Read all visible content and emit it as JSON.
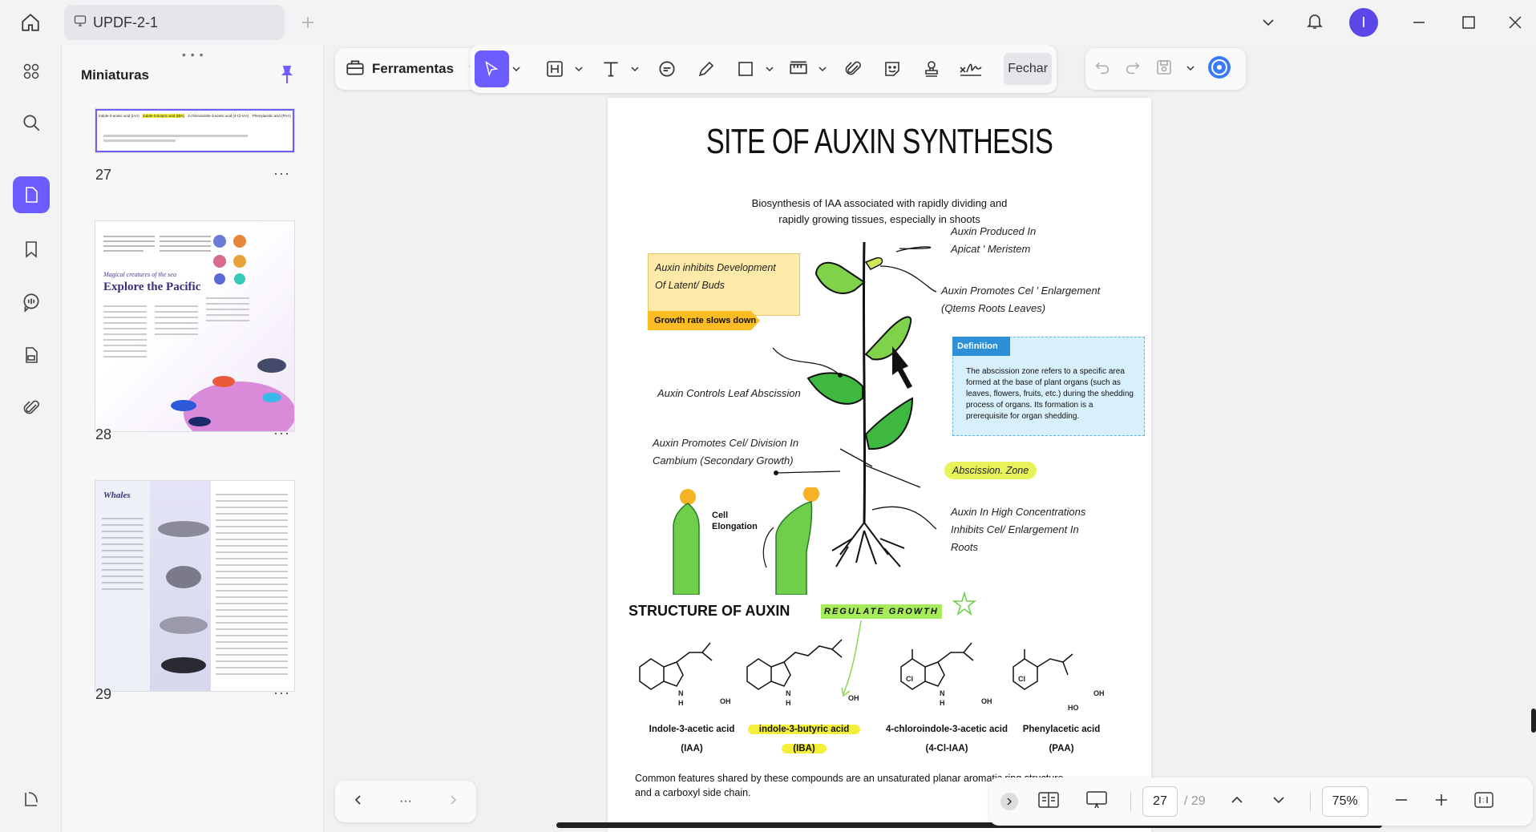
{
  "window": {
    "tab_title": "UPDF-2-1",
    "avatar_letter": "I",
    "accent": "#6d5cff"
  },
  "sidebar": {
    "panel_title": "Miniaturas",
    "thumbnails": [
      {
        "page": "27",
        "more": "···"
      },
      {
        "page": "28",
        "more": "···",
        "caption": "Magical creatures of the sea",
        "title": "Explore the Pacific"
      },
      {
        "page": "29",
        "more": "···",
        "title": "Whales"
      }
    ],
    "thumb27_labels": [
      "Indole-3-acetic acid (IAA)",
      "indole-3-butyric acid (IBA)",
      "4-chloroindole-3-acetic acid (4-Cl-IAA)",
      "Phenylacetic acid (PAA)"
    ]
  },
  "toolbar": {
    "tools_label": "Ferramentas",
    "close_label": "Fechar"
  },
  "document": {
    "title": "SITE OF AUXIN SYNTHESIS",
    "subtitle_line1": "Biosynthesis of IAA associated with rapidly dividing and",
    "subtitle_line2": "rapidly growing tissues, especially in shoots",
    "note_inhibit_line1": "Auxin inhibits Development",
    "note_inhibit_line2": "Of Latent/ Buds",
    "growth_tag": "Growth rate slows down",
    "produced_line1": "Auxin Produced In",
    "produced_line2": "Apicat ' Meristem",
    "promotes_line1": "Auxin Promotes Cel ' Enlargement",
    "promotes_line2": "(Qtems Roots Leaves)",
    "definition_tag": "Definition",
    "definition_text": "The abscission zone refers to a specific area formed at the base of plant organs (such as leaves, flowers, fruits, etc.) during the shedding process of organs. Its formation is a prerequisite for organ shedding.",
    "controls": "Auxin Controls Leaf Abscission",
    "division_line1": "Auxin Promotes Cel/ Division In",
    "division_line2": "Cambium (Secondary Growth)",
    "abscission_zone": "Abscission. Zone",
    "cell_elongation_line1": "Cell",
    "cell_elongation_line2": "Elongation",
    "high_conc_line1": "Auxin In High Concentrations",
    "high_conc_line2": "Inhibits Cel/ Enlargement In",
    "high_conc_line3": "Roots",
    "structure_title": "STRUCTURE OF AUXIN",
    "regulate_growth": "REGULATE GROWTH",
    "compounds": [
      {
        "name": "Indole-3-acetic acid",
        "abbr": "(IAA)"
      },
      {
        "name": "indole-3-butyric acid",
        "abbr": "(IBA)"
      },
      {
        "name": "4-chloroindole-3-acetic acid",
        "abbr": "(4-Cl-IAA)"
      },
      {
        "name": "Phenylacetic acid",
        "abbr": "(PAA)"
      }
    ],
    "chem_labels": {
      "oh": "OH",
      "h": "H",
      "n": "N",
      "cl": "Cl",
      "ho": "HO"
    },
    "footer_line1": "Common features shared by these compounds are an unsaturated planar aromatic ring structure",
    "footer_line2": "and a carboxyl side chain."
  },
  "pagination": {
    "current": "27",
    "total": "/ 29",
    "zoom": "75%",
    "more": "···"
  }
}
